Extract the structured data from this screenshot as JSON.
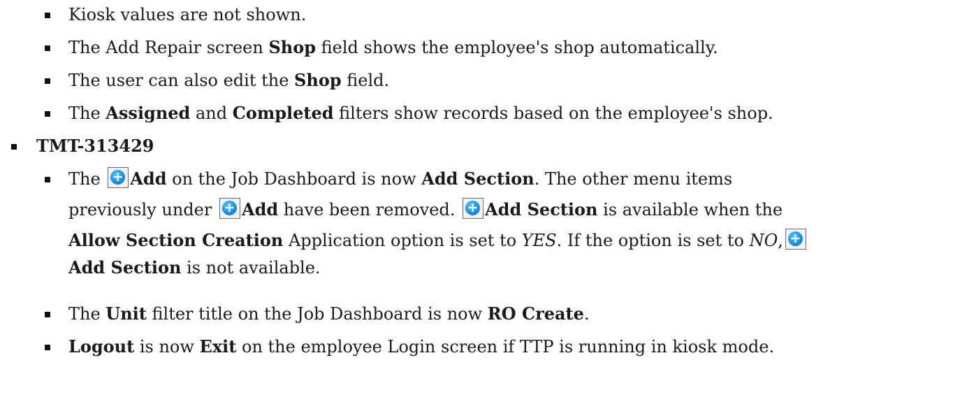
{
  "bullets_top": [
    {
      "text": "Kiosk values are not shown."
    },
    {
      "a": "The Add Repair screen ",
      "b": "Shop",
      "c": " field shows the employee's shop automatically."
    },
    {
      "a": "The user can also edit the ",
      "b": "Shop",
      "c": " field."
    },
    {
      "a": "The ",
      "b1": "Assigned",
      "m": " and ",
      "b2": "Completed",
      "c": " filters show records based on the employee's shop."
    }
  ],
  "ticket": "TMT-313429",
  "sub": {
    "add_section": {
      "l1_a": "The ",
      "l1_add": "Add",
      "l1_b": " on the Job Dashboard is now ",
      "l1_addsec": "Add Section",
      "l1_c": ". The other menu items",
      "l2_a": "previously under ",
      "l2_add": "Add",
      "l2_b": " have been removed. ",
      "l2_addsec": "Add Section",
      "l2_c": " is available when the",
      "l3_bold": "Allow Section Creation",
      "l3_a": " Application option is set to ",
      "l3_yes": "YES",
      "l3_b": ". If the option is set to ",
      "l3_no": "NO",
      "l3_c": ",",
      "l4_addsec": "Add Section",
      "l4_a": " is not available."
    },
    "unit": {
      "a": "The ",
      "unit": "Unit",
      "b": " filter title on the Job Dashboard is now ",
      "ro": "RO Create",
      "c": "."
    },
    "logout": {
      "logout": "Logout",
      "a": " is now ",
      "exit": "Exit",
      "b": " on the employee Login screen if TTP is running in kiosk mode."
    }
  },
  "icon": {
    "name": "add-circle-icon",
    "color": "#1a8fe0"
  }
}
